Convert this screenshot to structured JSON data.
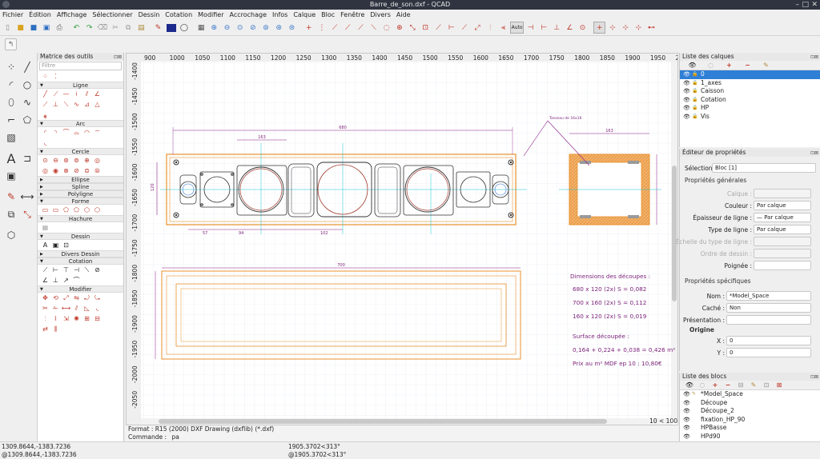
{
  "window": {
    "title": "Barre_de_son.dxf - QCAD"
  },
  "menu": [
    "Fichier",
    "Édition",
    "Affichage",
    "Sélectionner",
    "Dessin",
    "Cotation",
    "Modifier",
    "Accrochage",
    "Infos",
    "Calque",
    "Bloc",
    "Fenêtre",
    "Divers",
    "Aide"
  ],
  "toolbar": {
    "auto_label": "Auto"
  },
  "tool_matrix": {
    "title": "Matrice des outils",
    "filter_placeholder": "Filtre",
    "categories": [
      "Ligne",
      "Arc",
      "Cercle",
      "Ellipse",
      "Spline",
      "Polyligne",
      "Forme",
      "Hachure",
      "Dessin",
      "Divers Dessin",
      "Cotation",
      "Modifier"
    ]
  },
  "ruler": {
    "x_ticks": [
      "900",
      "1000",
      "1050",
      "1100",
      "1150",
      "1200",
      "1250",
      "1300",
      "1350",
      "1400",
      "1450",
      "1500",
      "1550",
      "1600",
      "1650",
      "1700",
      "1750",
      "1800",
      "1850",
      "1900",
      "1950",
      "2000",
      "20"
    ],
    "y_ticks": [
      "-1400",
      "-1450",
      "-1500",
      "-1550",
      "-1600",
      "-1650",
      "-1700",
      "-1750",
      "-1800",
      "-1850",
      "-1900",
      "-1950",
      "-2000",
      "-2050"
    ]
  },
  "drawing": {
    "notes": {
      "dims_title": "Dimensions des découpes :",
      "dim1": "680 x 120 (2x)  S = 0,082",
      "dim2": "700 x 160 (2x)  S = 0,112",
      "dim3": "160 x 120 (2x)  S = 0,019",
      "surface_title": "Surface découpée :",
      "surface_calc": "0,164 + 0,224 + 0,038 = 0,426 m²",
      "price": "Prix au m² MDF ep 10 : 10,80€",
      "tasseau": "Tasseau de 16x16"
    },
    "dims": {
      "top": "680",
      "speaker": "163",
      "right_width": "163",
      "bottom": "700",
      "small1": "57",
      "small2": "94",
      "small3": "102",
      "left_height": "120"
    },
    "scale_info": "10 < 100"
  },
  "status": {
    "format": "Format : R15 (2000) DXF Drawing (dxflib) (*.dxf)",
    "command_label": "Commande :",
    "command_value": "pa"
  },
  "layers_panel": {
    "title": "Liste des calques",
    "layers": [
      {
        "name": "0",
        "selected": true
      },
      {
        "name": "1_axes",
        "selected": false
      },
      {
        "name": "Caisson",
        "selected": false
      },
      {
        "name": "Cotation",
        "selected": false
      },
      {
        "name": "HP",
        "selected": false
      },
      {
        "name": "Vis",
        "selected": false
      }
    ]
  },
  "property_editor": {
    "title": "Éditeur de propriétés",
    "selection_label": "Sélection :",
    "selection_value": "Bloc [1]",
    "general_title": "Propriétés générales",
    "layer_label": "Calque :",
    "color_label": "Couleur :",
    "color_value": "Par calque",
    "lineweight_label": "Épaisseur de ligne :",
    "lineweight_value": "— Par calque",
    "linetype_label": "Type de ligne :",
    "linetype_value": "Par calque",
    "linetype_scale_label": "Échelle du type de ligne :",
    "draw_order_label": "Ordre de dessin :",
    "handles_label": "Poignée :",
    "specific_title": "Propriétés spécifiques",
    "name_label": "Nom :",
    "name_value": "*Model_Space",
    "hidden_label": "Caché :",
    "hidden_value": "Non",
    "presentation_label": "Présentation :",
    "origin_label": "Origine",
    "x_label": "X :",
    "x_value": "0",
    "y_label": "Y :",
    "y_value": "0"
  },
  "blocks_panel": {
    "title": "Liste des blocs",
    "blocks": [
      "*Model_Space",
      "Découpe",
      "Découpe_2",
      "fixation_HP_90",
      "HPBasse",
      "HPd90"
    ]
  },
  "bottom": {
    "coord_abs": "1309.8644,-1383.7236",
    "coord_rel": "@1309.8644,-1383.7236",
    "polar_abs": "1905.3702<313°",
    "polar_rel": "@1905.3702<313°"
  },
  "colors": {
    "accent": "#2f7fd6",
    "caisson": "#e8922d",
    "dimension": "#8a1f86",
    "axes": "#19c2d6"
  }
}
